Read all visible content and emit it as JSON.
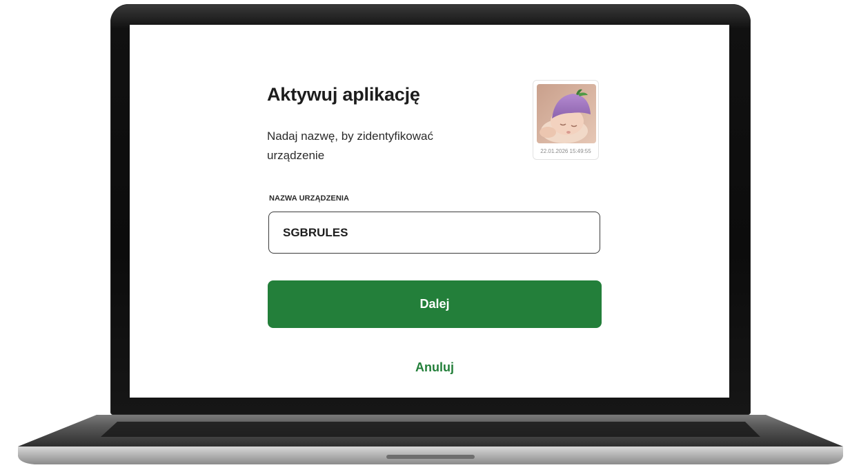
{
  "screen": {
    "title": "Aktywuj aplikację",
    "subtitle": "Nadaj nazwę, by zidentyfikować urządzenie",
    "photo": {
      "icon": "baby-photo",
      "timestamp": "22.01.2026 15:49:55"
    },
    "field": {
      "label": "NAZWA URZĄDZENIA",
      "value": "SGBRULES"
    },
    "primary_button": "Dalej",
    "secondary_link": "Anuluj"
  },
  "colors": {
    "accent": "#237f3a",
    "text": "#1d1d1d",
    "laptop_bezel": "#111111"
  }
}
